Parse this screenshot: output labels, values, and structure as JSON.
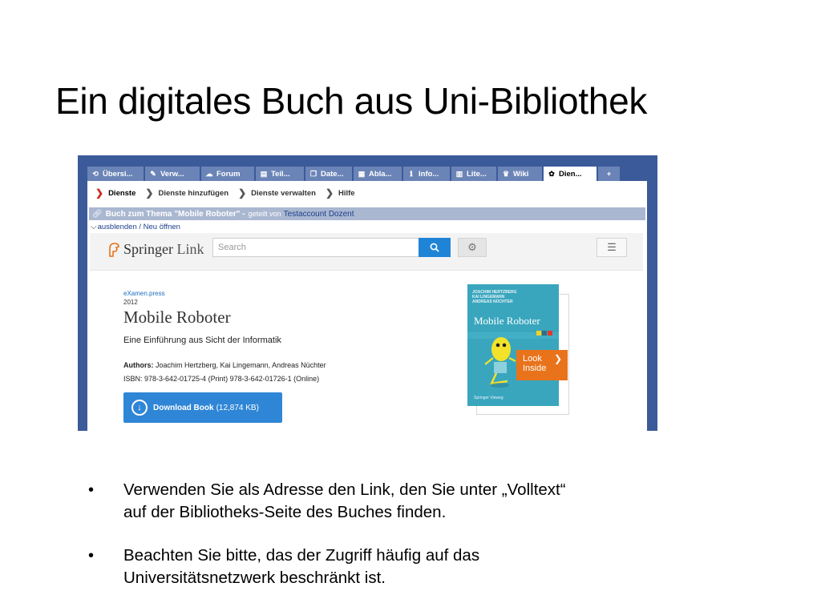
{
  "slide": {
    "title": "Ein digitales Buch aus Uni-Bibliothek",
    "bullets": [
      {
        "line1": "Verwenden Sie als Adresse den Link, den Sie unter „Volltext“",
        "line2": "auf der Bibliotheks-Seite des Buches finden."
      },
      {
        "line1": "Beachten Sie bitte, das der Zugriff häufig auf das",
        "line2": "Universitätsnetzwerk beschränkt ist."
      }
    ]
  },
  "lms": {
    "tabs": [
      {
        "icon": "overview-icon",
        "glyph": "⟲",
        "label": "Übersi..."
      },
      {
        "icon": "admin-icon",
        "glyph": "✎",
        "label": "Verw..."
      },
      {
        "icon": "forum-icon",
        "glyph": "☁",
        "label": "Forum"
      },
      {
        "icon": "participants-icon",
        "glyph": "▤",
        "label": "Teil..."
      },
      {
        "icon": "files-icon",
        "glyph": "❐",
        "label": "Date..."
      },
      {
        "icon": "schedule-icon",
        "glyph": "▦",
        "label": "Abla..."
      },
      {
        "icon": "info-icon",
        "glyph": "ℹ",
        "label": "Info..."
      },
      {
        "icon": "literature-icon",
        "glyph": "▥",
        "label": "Lite..."
      },
      {
        "icon": "wiki-icon",
        "glyph": "♛",
        "label": "Wiki"
      },
      {
        "icon": "services-icon",
        "glyph": "✿",
        "label": "Dien..."
      },
      {
        "icon": "plus-icon",
        "glyph": "+",
        "label": ""
      }
    ],
    "active_tab": 9,
    "subnav": [
      "Dienste",
      "Dienste hinzufügen",
      "Dienste verwalten",
      "Hilfe"
    ],
    "share": {
      "title": "Buch zum Thema \"Mobile Roboter\" -",
      "shared_by": "geteilt von",
      "user": "Testaccount Dozent"
    },
    "toggle": "ausblenden / Neu öffnen"
  },
  "springer": {
    "logo_word1": "Springer",
    "logo_word2": "Link",
    "search_placeholder": "Search",
    "series": "eXamen.press",
    "year": "2012",
    "title": "Mobile Roboter",
    "subtitle": "Eine Einführung aus Sicht der Informatik",
    "authors_label": "Authors:",
    "authors": "Joachim Hertzberg, Kai Lingemann, Andreas Nüchter",
    "isbn": "ISBN: 978-3-642-01725-4 (Print) 978-3-642-01726-1 (Online)",
    "download_label": "Download Book",
    "download_size": "(12,874 KB)",
    "cover": {
      "authors": [
        "JOACHIM HERTZBERG",
        "KAI LINGEMANN",
        "ANDREAS NÜCHTER"
      ],
      "title": "Mobile Roboter",
      "publisher": "Springer Vieweg"
    },
    "look_inside": [
      "Look",
      "Inside"
    ]
  },
  "colors": {
    "frame": "#3b5a9a",
    "tab": "#6b84b7",
    "search_button": "#1f84d6",
    "download_button": "#2f86d6",
    "look_inside": "#e8731b",
    "cover": "#39a6be"
  }
}
